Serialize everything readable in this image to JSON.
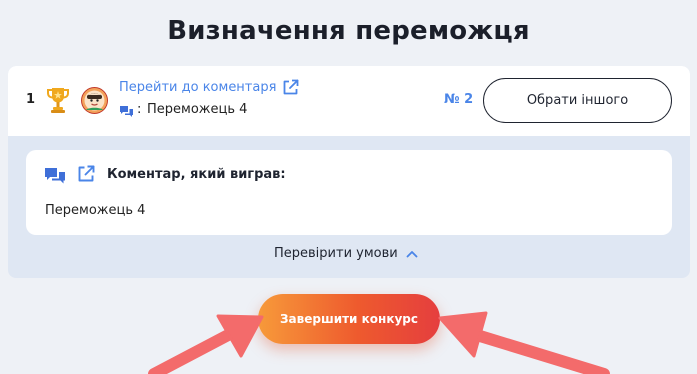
{
  "page": {
    "title": "Визначення переможця"
  },
  "winner": {
    "place": "1",
    "goto_comment_label": "Перейти до коментаря",
    "colon": ":",
    "name": "Переможець 4",
    "number_label": "№ 2",
    "choose_another_label": "Обрати іншого",
    "icons": [
      "trophy-icon",
      "avatar-icon",
      "external-link-icon",
      "comments-icon"
    ]
  },
  "comment_card": {
    "heading": "Коментар, який виграв:",
    "text": "Переможець 4",
    "icons": [
      "comments-icon",
      "external-link-icon"
    ]
  },
  "check_conditions": {
    "label": "Перевірити умови",
    "icon": "chevron-up-icon"
  },
  "finish_button": {
    "label": "Завершити конкурс"
  },
  "colors": {
    "accent_blue": "#4a85e8",
    "trophy_gold": "#f0a81e",
    "finish_gradient_start": "#f79a3a",
    "finish_gradient_end": "#e53e3e",
    "annotation_arrow": "#f36b6b",
    "panel_background": "#dfe7f3",
    "page_background": "#eef1f6"
  }
}
